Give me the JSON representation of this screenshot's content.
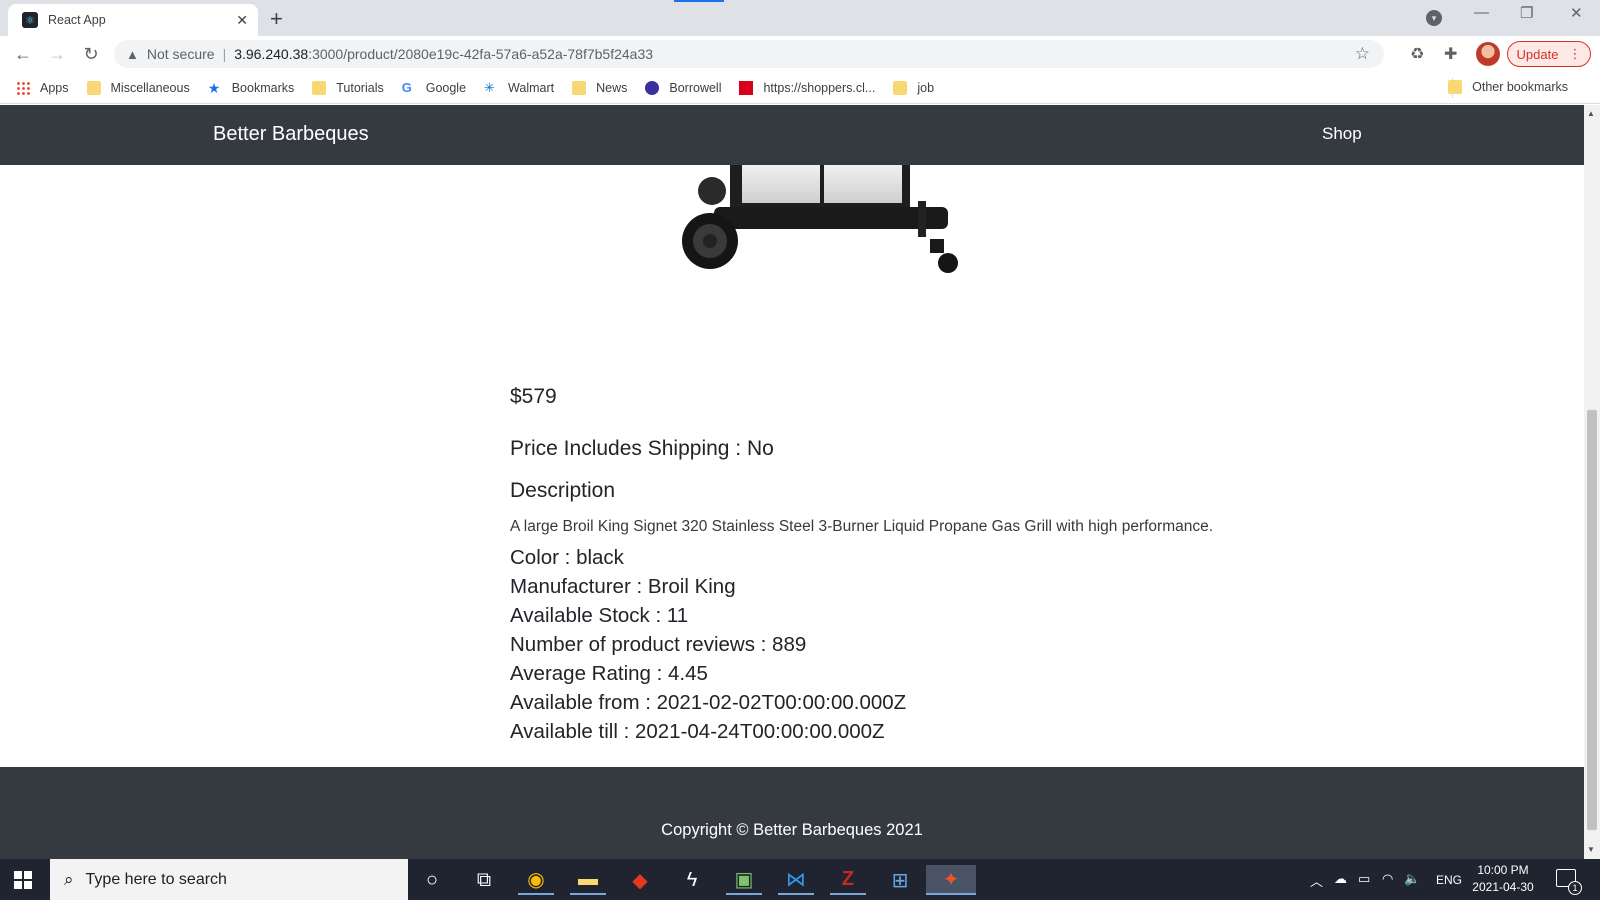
{
  "browser": {
    "tab_title": "React App",
    "new_tab_symbol": "+",
    "url_warning": "Not secure",
    "url_separator": "|",
    "url_host": "3.96.240.38",
    "url_path": ":3000/product/2080e19c-42fa-57a6-a52a-78f7b5f24a33",
    "update_label": "Update",
    "bookmarks": [
      {
        "label": "Apps",
        "icon": "apps-icon"
      },
      {
        "label": "Miscellaneous",
        "icon": "folder-icon"
      },
      {
        "label": "Bookmarks",
        "icon": "star-icon"
      },
      {
        "label": "Tutorials",
        "icon": "folder-icon"
      },
      {
        "label": "Google",
        "icon": "google-icon"
      },
      {
        "label": "Walmart",
        "icon": "walmart-icon"
      },
      {
        "label": "News",
        "icon": "folder-icon"
      },
      {
        "label": "Borrowell",
        "icon": "borrowell-icon"
      },
      {
        "label": "https://shoppers.cl...",
        "icon": "infor-icon"
      },
      {
        "label": "job",
        "icon": "folder-icon"
      }
    ],
    "other_bookmarks": "Other bookmarks"
  },
  "site": {
    "brand": "Better Barbeques",
    "nav_shop": "Shop",
    "footer_copyright": "Copyright © Better Barbeques 2021"
  },
  "product": {
    "price": "$579",
    "shipping": "Price Includes Shipping : No",
    "description_heading": "Description",
    "description": "A large Broil King Signet 320 Stainless Steel 3-Burner Liquid Propane Gas Grill with high performance.",
    "specs": [
      "Color : black",
      "Manufacturer : Broil King",
      "Available Stock : 11",
      "Number of product reviews : 889",
      "Average Rating : 4.45",
      "Available from : 2021-02-02T00:00:00.000Z",
      "Available till : 2021-04-24T00:00:00.000Z"
    ]
  },
  "taskbar": {
    "search_placeholder": "Type here to search",
    "language": "ENG",
    "time": "10:00 PM",
    "date": "2021-04-30",
    "notification_count": "1"
  },
  "colors": {
    "navbar": "#343a40",
    "update_red": "#d93025"
  }
}
